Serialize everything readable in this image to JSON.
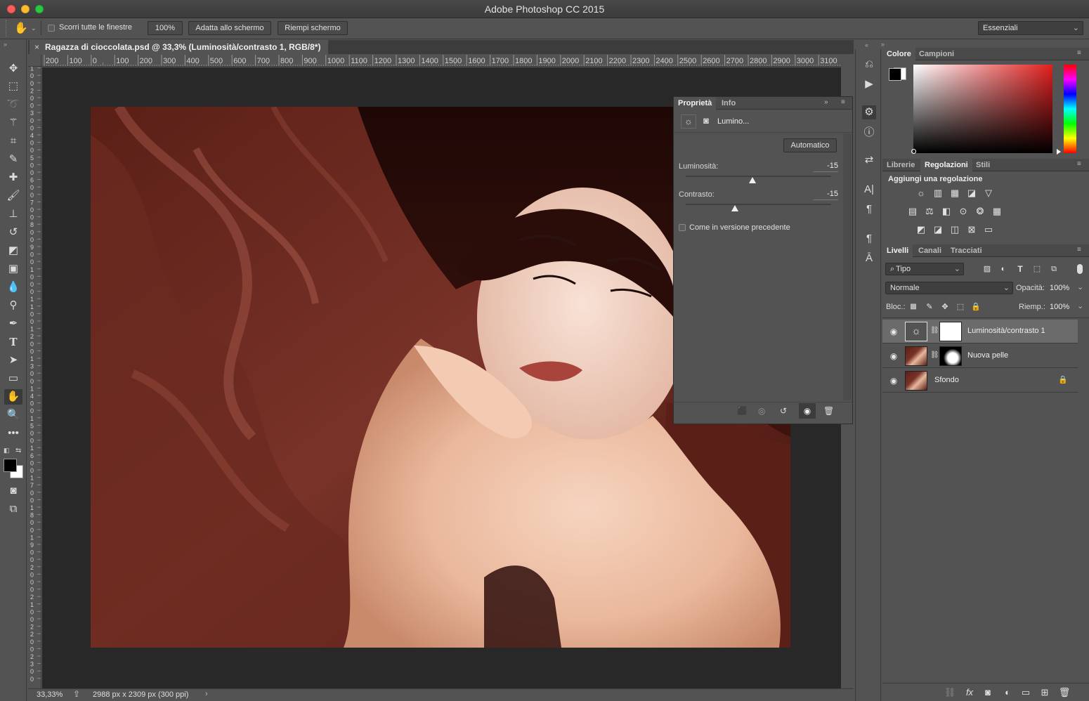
{
  "app": {
    "title": "Adobe Photoshop CC 2015"
  },
  "options_bar": {
    "scroll_all_label": "Scorri tutte le finestre",
    "zoom_btn": "100%",
    "fit_btn": "Adatta allo schermo",
    "fill_btn": "Riempi schermo",
    "workspace": "Essenziali"
  },
  "document": {
    "tab_title": "Ragazza di cioccolata.psd @ 33,3% (Luminosità/contrasto 1, RGB/8*)",
    "ruler_top_ticks": [
      "200",
      "100",
      "0",
      "100",
      "200",
      "300",
      "400",
      "500",
      "600",
      "700",
      "800",
      "900",
      "1000",
      "1100",
      "1200",
      "1300",
      "1400",
      "1500",
      "1600",
      "1700",
      "1800",
      "1900",
      "2000",
      "2100",
      "2200",
      "2300",
      "2400",
      "2500",
      "2600",
      "2700",
      "2800",
      "2900",
      "3000",
      "3100"
    ],
    "ruler_left_ticks": [
      "0",
      "1",
      "0",
      "0",
      "2",
      "0",
      "0",
      "3",
      "0",
      "0",
      "4",
      "0",
      "0",
      "5",
      "0",
      "0",
      "6",
      "0",
      "0",
      "7",
      "0",
      "0",
      "8",
      "0",
      "0",
      "9",
      "0",
      "0",
      "1",
      "0",
      "0",
      "0",
      "1",
      "1",
      "0",
      "0",
      "1",
      "2",
      "0",
      "0",
      "1",
      "3",
      "0",
      "0",
      "1",
      "4",
      "0",
      "0",
      "1",
      "5",
      "0",
      "0",
      "1",
      "6",
      "0",
      "0",
      "1",
      "7",
      "0",
      "0",
      "1",
      "8",
      "0",
      "0",
      "1",
      "9",
      "0",
      "0",
      "2",
      "0",
      "0",
      "0",
      "2",
      "1",
      "0",
      "0",
      "2",
      "2",
      "0",
      "0",
      "2",
      "3",
      "0",
      "0"
    ],
    "zoom": "33,33%",
    "dimensions": "2988 px x 2309 px (300 ppi)"
  },
  "properties_panel": {
    "tabs": [
      "Proprietà",
      "Info"
    ],
    "layer_label": "Lumino...",
    "auto_btn": "Automatico",
    "brightness_label": "Luminosità:",
    "brightness_value": "-15",
    "brightness_level": 0.46,
    "contrast_label": "Contrasto:",
    "contrast_value": "-15",
    "contrast_level": 0.34,
    "legacy_label": "Come in versione precedente"
  },
  "color_panel": {
    "tabs": [
      "Colore",
      "Campioni"
    ]
  },
  "adjustments_panel": {
    "tabs": [
      "Librerie",
      "Regolazioni",
      "Stili"
    ],
    "heading": "Aggiungi una regolazione",
    "row1_icons": [
      "brightness-icon",
      "levels-icon",
      "curves-icon",
      "exposure-icon",
      "vibrance-icon"
    ],
    "row2_icons": [
      "hue-sat-icon",
      "color-balance-icon",
      "bw-icon",
      "photo-filter-icon",
      "channel-mixer-icon",
      "color-lookup-icon"
    ],
    "row3_icons": [
      "invert-icon",
      "posterize-icon",
      "threshold-icon",
      "selective-color-icon",
      "gradient-map-icon"
    ]
  },
  "layers_panel": {
    "tabs": [
      "Livelli",
      "Canali",
      "Tracciati"
    ],
    "filter": "Tipo",
    "blend_mode": "Normale",
    "opacity_label": "Opacità:",
    "opacity_value": "100%",
    "lock_label": "Bloc.:",
    "fill_label": "Riemp.:",
    "fill_value": "100%",
    "layers": [
      {
        "name": "Luminosità/contrasto 1",
        "selected": true
      },
      {
        "name": "Nuova pelle",
        "selected": false
      },
      {
        "name": "Sfondo",
        "selected": false,
        "locked": true
      }
    ]
  },
  "colors": {
    "accent_selected": "#6b6b6b",
    "panel_bg": "#535353",
    "canvas_bg": "#282828"
  }
}
